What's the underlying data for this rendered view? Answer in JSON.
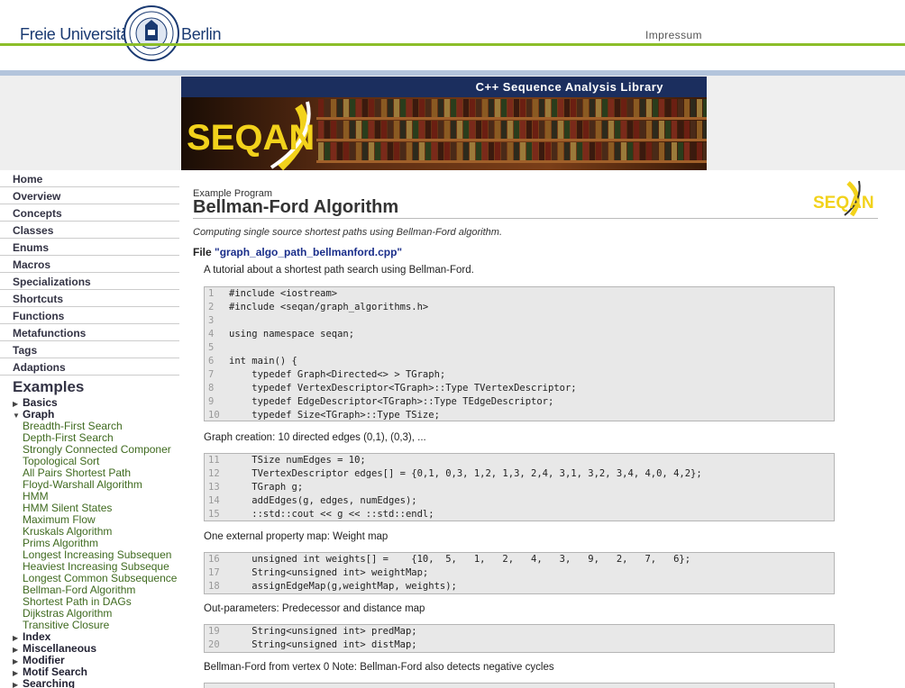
{
  "header": {
    "fu_left": "Freie Universität",
    "fu_right": "Berlin",
    "impressum": "Impressum",
    "banner_title": "C++ Sequence Analysis Library",
    "logo_text": "SEQAN"
  },
  "nav": {
    "items": [
      "Home",
      "Overview",
      "Concepts",
      "Classes",
      "Enums",
      "Macros",
      "Specializations",
      "Shortcuts",
      "Functions",
      "Metafunctions",
      "Tags",
      "Adaptions"
    ],
    "examples_heading": "Examples",
    "tree": {
      "basics": "Basics",
      "graph": "Graph",
      "graph_children": [
        "Breadth-First Search",
        "Depth-First Search",
        "Strongly Connected Componer",
        "Topological Sort",
        "All Pairs Shortest Path",
        "Floyd-Warshall Algorithm",
        "HMM",
        "HMM Silent States",
        "Maximum Flow",
        "Kruskals Algorithm",
        "Prims Algorithm",
        "Longest Increasing Subsequen",
        "Heaviest Increasing Subseque",
        "Longest Common Subsequence",
        "Bellman-Ford Algorithm",
        "Shortest Path in DAGs",
        "Dijkstras Algorithm",
        "Transitive Closure"
      ],
      "index": "Index",
      "miscellaneous": "Miscellaneous",
      "modifier": "Modifier",
      "motif_search": "Motif Search",
      "searching": "Searching"
    }
  },
  "main": {
    "kicker": "Example Program",
    "title": "Bellman-Ford Algorithm",
    "lead": "Computing single source shortest paths using Bellman-Ford algorithm.",
    "file_prefix": "File ",
    "file_name": "\"graph_algo_path_bellmanford.cpp\"",
    "intro": "A tutorial about a shortest path search using Bellman-Ford.",
    "sections": [
      "Graph creation: 10 directed edges (0,1), (0,3), ...",
      "One external property map: Weight map",
      "Out-parameters: Predecessor and distance map",
      "Bellman-Ford from vertex 0 Note: Bellman-Ford also detects negative cycles"
    ],
    "code_blocks": [
      [
        {
          "n": "1",
          "code": "#include <iostream>"
        },
        {
          "n": "2",
          "code": "#include <seqan/graph_algorithms.h>"
        },
        {
          "n": "3",
          "code": ""
        },
        {
          "n": "4",
          "code": "using namespace seqan;"
        },
        {
          "n": "5",
          "code": ""
        },
        {
          "n": "6",
          "code": "int main() {"
        },
        {
          "n": "7",
          "code": "    typedef Graph<Directed<> > TGraph;"
        },
        {
          "n": "8",
          "code": "    typedef VertexDescriptor<TGraph>::Type TVertexDescriptor;"
        },
        {
          "n": "9",
          "code": "    typedef EdgeDescriptor<TGraph>::Type TEdgeDescriptor;"
        },
        {
          "n": "10",
          "code": "    typedef Size<TGraph>::Type TSize;"
        }
      ],
      [
        {
          "n": "11",
          "code": "    TSize numEdges = 10;"
        },
        {
          "n": "12",
          "code": "    TVertexDescriptor edges[] = {0,1, 0,3, 1,2, 1,3, 2,4, 3,1, 3,2, 3,4, 4,0, 4,2};"
        },
        {
          "n": "13",
          "code": "    TGraph g;"
        },
        {
          "n": "14",
          "code": "    addEdges(g, edges, numEdges);"
        },
        {
          "n": "15",
          "code": "    ::std::cout << g << ::std::endl;"
        }
      ],
      [
        {
          "n": "16",
          "code": "    unsigned int weights[] =    {10,  5,   1,   2,   4,   3,   9,   2,   7,   6};"
        },
        {
          "n": "17",
          "code": "    String<unsigned int> weightMap;"
        },
        {
          "n": "18",
          "code": "    assignEdgeMap(g,weightMap, weights);"
        }
      ],
      [
        {
          "n": "19",
          "code": "    String<unsigned int> predMap;"
        },
        {
          "n": "20",
          "code": "    String<unsigned int> distMap;"
        }
      ]
    ]
  },
  "colors": {
    "nav_text": "#334455",
    "link_green": "#3f6a1f",
    "banner_blue": "#1b2e5e",
    "accent_green": "#8cbe29",
    "logo_yellow": "#f2d21b"
  }
}
